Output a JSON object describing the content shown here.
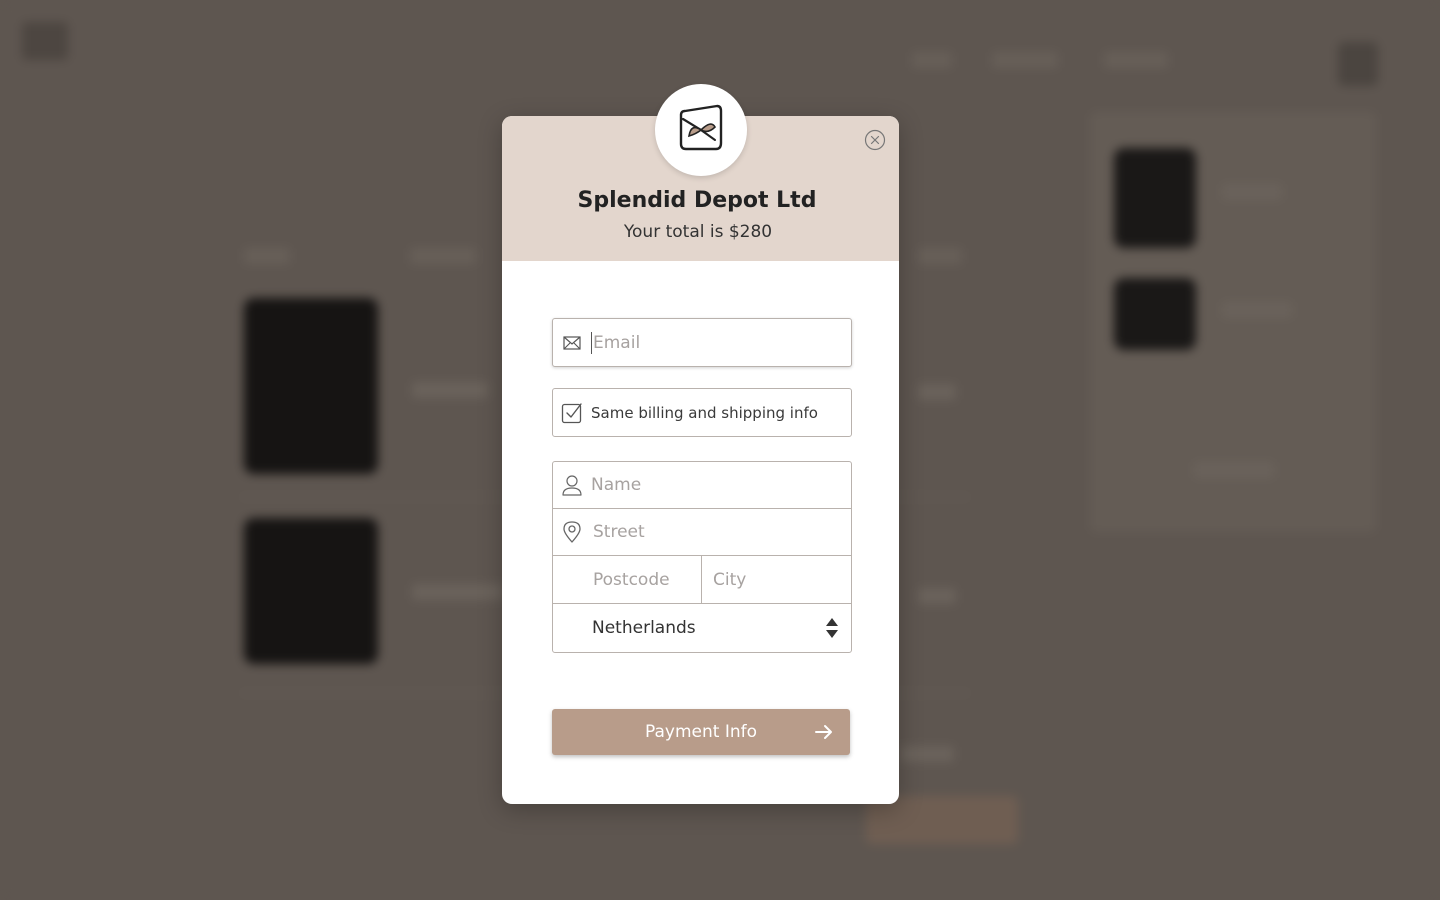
{
  "modal": {
    "company_name": "Splendid Depot Ltd",
    "total_text": "Your total is $280",
    "email_placeholder": "Email",
    "same_info_label": "Same billing and shipping info",
    "same_info_checked": true,
    "name_placeholder": "Name",
    "street_placeholder": "Street",
    "postcode_placeholder": "Postcode",
    "city_placeholder": "City",
    "country_value": "Netherlands",
    "payment_button_label": "Payment Info"
  },
  "icons": {
    "logo": "bird-logo-icon",
    "close": "close-circle-icon",
    "email": "envelope-icon",
    "checkbox": "checkbox-checked-icon",
    "name": "user-icon",
    "street": "map-pin-icon",
    "select": "select-arrows-icon",
    "button": "arrow-right-icon"
  },
  "colors": {
    "overlay": "#5e5650",
    "header_bg": "#e3d6cd",
    "button_bg": "#b89c8a",
    "field_border": "#b9b2ad"
  }
}
